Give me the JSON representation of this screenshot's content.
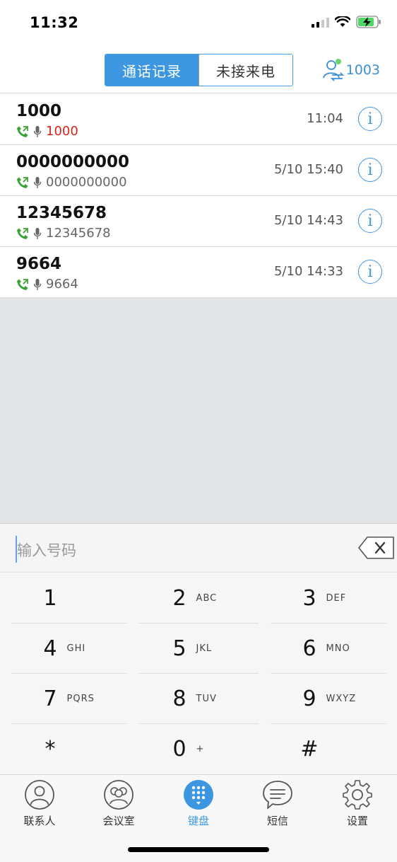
{
  "status": {
    "time": "11:32"
  },
  "header": {
    "tabs": [
      {
        "label": "通话记录",
        "active": true
      },
      {
        "label": "未接来电",
        "active": false
      }
    ],
    "extension": "1003"
  },
  "calls": [
    {
      "number": "1000",
      "detail": "1000",
      "missed": true,
      "time": "11:04"
    },
    {
      "number": "0000000000",
      "detail": "0000000000",
      "missed": false,
      "time": "5/10 15:40"
    },
    {
      "number": "12345678",
      "detail": "12345678",
      "missed": false,
      "time": "5/10 14:43"
    },
    {
      "number": "9664",
      "detail": "9664",
      "missed": false,
      "time": "5/10 14:33"
    }
  ],
  "dialer": {
    "placeholder": "输入号码",
    "keys": [
      {
        "digit": "1",
        "letters": ""
      },
      {
        "digit": "2",
        "letters": "ABC"
      },
      {
        "digit": "3",
        "letters": "DEF"
      },
      {
        "digit": "4",
        "letters": "GHI"
      },
      {
        "digit": "5",
        "letters": "JKL"
      },
      {
        "digit": "6",
        "letters": "MNO"
      },
      {
        "digit": "7",
        "letters": "PQRS"
      },
      {
        "digit": "8",
        "letters": "TUV"
      },
      {
        "digit": "9",
        "letters": "WXYZ"
      },
      {
        "digit": "*",
        "letters": ""
      },
      {
        "digit": "0",
        "letters": "+"
      },
      {
        "digit": "#",
        "letters": ""
      }
    ]
  },
  "tabbar": {
    "items": [
      {
        "label": "联系人",
        "icon": "contact-icon",
        "active": false
      },
      {
        "label": "会议室",
        "icon": "conference-icon",
        "active": false
      },
      {
        "label": "键盘",
        "icon": "keypad-icon",
        "active": true
      },
      {
        "label": "短信",
        "icon": "message-icon",
        "active": false
      },
      {
        "label": "设置",
        "icon": "settings-icon",
        "active": false
      }
    ]
  },
  "colors": {
    "accent": "#3d97e0",
    "missed": "#d8231b",
    "call_icon": "#3aa33a",
    "online_dot": "#6bd36b"
  }
}
